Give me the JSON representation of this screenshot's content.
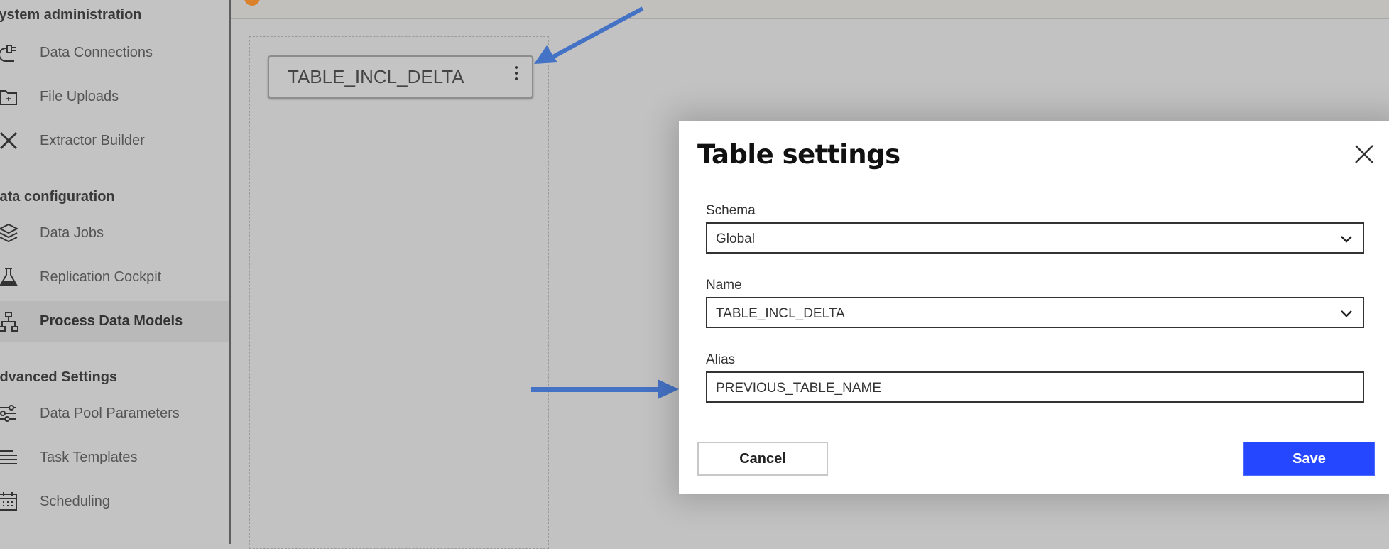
{
  "sidebar": {
    "sections": [
      {
        "title": "System administration",
        "items": [
          {
            "label": "Data Connections",
            "icon": "plug-icon"
          },
          {
            "label": "File Uploads",
            "icon": "folder-plus-icon"
          },
          {
            "label": "Extractor Builder",
            "icon": "tools-icon"
          }
        ]
      },
      {
        "title": "Data configuration",
        "items": [
          {
            "label": "Data Jobs",
            "icon": "layers-icon"
          },
          {
            "label": "Replication Cockpit",
            "icon": "flask-icon"
          },
          {
            "label": "Process Data Models",
            "icon": "hierarchy-icon",
            "active": true
          }
        ]
      },
      {
        "title": "Advanced Settings",
        "items": [
          {
            "label": "Data Pool Parameters",
            "icon": "sliders-icon"
          },
          {
            "label": "Task Templates",
            "icon": "list-icon"
          },
          {
            "label": "Scheduling",
            "icon": "calendar-icon"
          }
        ]
      }
    ]
  },
  "canvas": {
    "table_node_label": "TABLE_INCL_DELTA"
  },
  "dialog": {
    "title": "Table settings",
    "schema_label": "Schema",
    "schema_value": "Global",
    "name_label": "Name",
    "name_value": "TABLE_INCL_DELTA",
    "alias_label": "Alias",
    "alias_value": "PREVIOUS_TABLE_NAME",
    "cancel_label": "Cancel",
    "save_label": "Save"
  },
  "colors": {
    "primary": "#2447ff",
    "annotation_arrow": "#4472c4",
    "status_dot": "#d9822b"
  }
}
